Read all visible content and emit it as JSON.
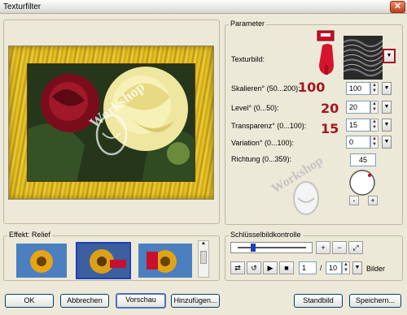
{
  "window": {
    "title": "Texturfilter",
    "close_glyph": "✕"
  },
  "preview": {
    "watermark": "Workshop"
  },
  "parameter": {
    "group_label": "Parameter",
    "texture_label": "Texturbild:",
    "rows": [
      {
        "label": "Skalieren° (50...200):",
        "value": "100",
        "annotation": "100"
      },
      {
        "label": "Level° (0...50):",
        "value": "20",
        "annotation": "20"
      },
      {
        "label": "Transparenz° (0...100):",
        "value": "15",
        "annotation": "15"
      },
      {
        "label": "Variation° (0...100):",
        "value": "0",
        "annotation": ""
      }
    ],
    "direction_label": "Richtung (0...359):",
    "direction_value": "45",
    "dial_minus": "-",
    "dial_plus": "+",
    "watermark": "Workshop"
  },
  "effect": {
    "label": "Effekt: Relief",
    "thumbnails": [
      "sunflower-relief-1",
      "sunflower-relief-2",
      "sunflower-relief-3"
    ]
  },
  "keyframes": {
    "label": "Schlüsselbildkontrolle",
    "frame_current": "1",
    "frame_separator": "/",
    "frame_total": "10",
    "frames_unit": "Bilder"
  },
  "buttons": {
    "ok": "OK",
    "cancel": "Abbrechen",
    "preview": "Vorschau",
    "add": "Hinzufügen...",
    "default": "Standbild",
    "save": "Speichern..."
  },
  "colors": {
    "annotation_red": "#a31621",
    "frame_gold": "#d6ad19",
    "selection_blue": "#1f3fbf"
  }
}
